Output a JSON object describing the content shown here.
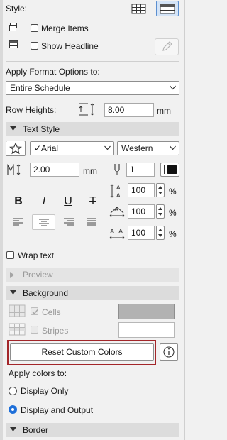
{
  "style": {
    "label": "Style:"
  },
  "merge_items": {
    "label": "Merge Items",
    "checked": false
  },
  "show_headline": {
    "label": "Show Headline",
    "checked": false
  },
  "apply_format": {
    "label": "Apply Format Options to:",
    "value": "Entire Schedule"
  },
  "row_heights": {
    "label": "Row Heights:",
    "value": "8.00",
    "unit": "mm"
  },
  "text_style": {
    "title": "Text Style",
    "font": "✓Arial",
    "script": "Western",
    "size_value": "2.00",
    "size_unit": "mm",
    "pen_value": "1",
    "spacing": [
      {
        "value": "100",
        "unit": "%"
      },
      {
        "value": "100",
        "unit": "%"
      },
      {
        "value": "100",
        "unit": "%"
      }
    ],
    "format_buttons": {
      "bold": "B",
      "italic": "I",
      "underline": "U",
      "strike": "T"
    }
  },
  "wrap_text": {
    "label": "Wrap text",
    "checked": false
  },
  "preview": {
    "title": "Preview"
  },
  "background": {
    "title": "Background",
    "cells_label": "Cells",
    "cells_checked": true,
    "cells_color": "#b2b2b2",
    "stripes_label": "Stripes",
    "stripes_checked": false,
    "stripes_color": "#ffffff"
  },
  "reset_button": {
    "label": "Reset Custom Colors"
  },
  "apply_colors": {
    "label": "Apply colors to:",
    "options": [
      {
        "label": "Display Only",
        "selected": false
      },
      {
        "label": "Display and Output",
        "selected": true
      }
    ]
  },
  "border": {
    "title": "Border"
  },
  "colors": {
    "accent": "#1e6fd9",
    "highlight": "#a3262a",
    "section_bg": "#dcdcdc",
    "panel_bg": "#f1f1f1"
  }
}
